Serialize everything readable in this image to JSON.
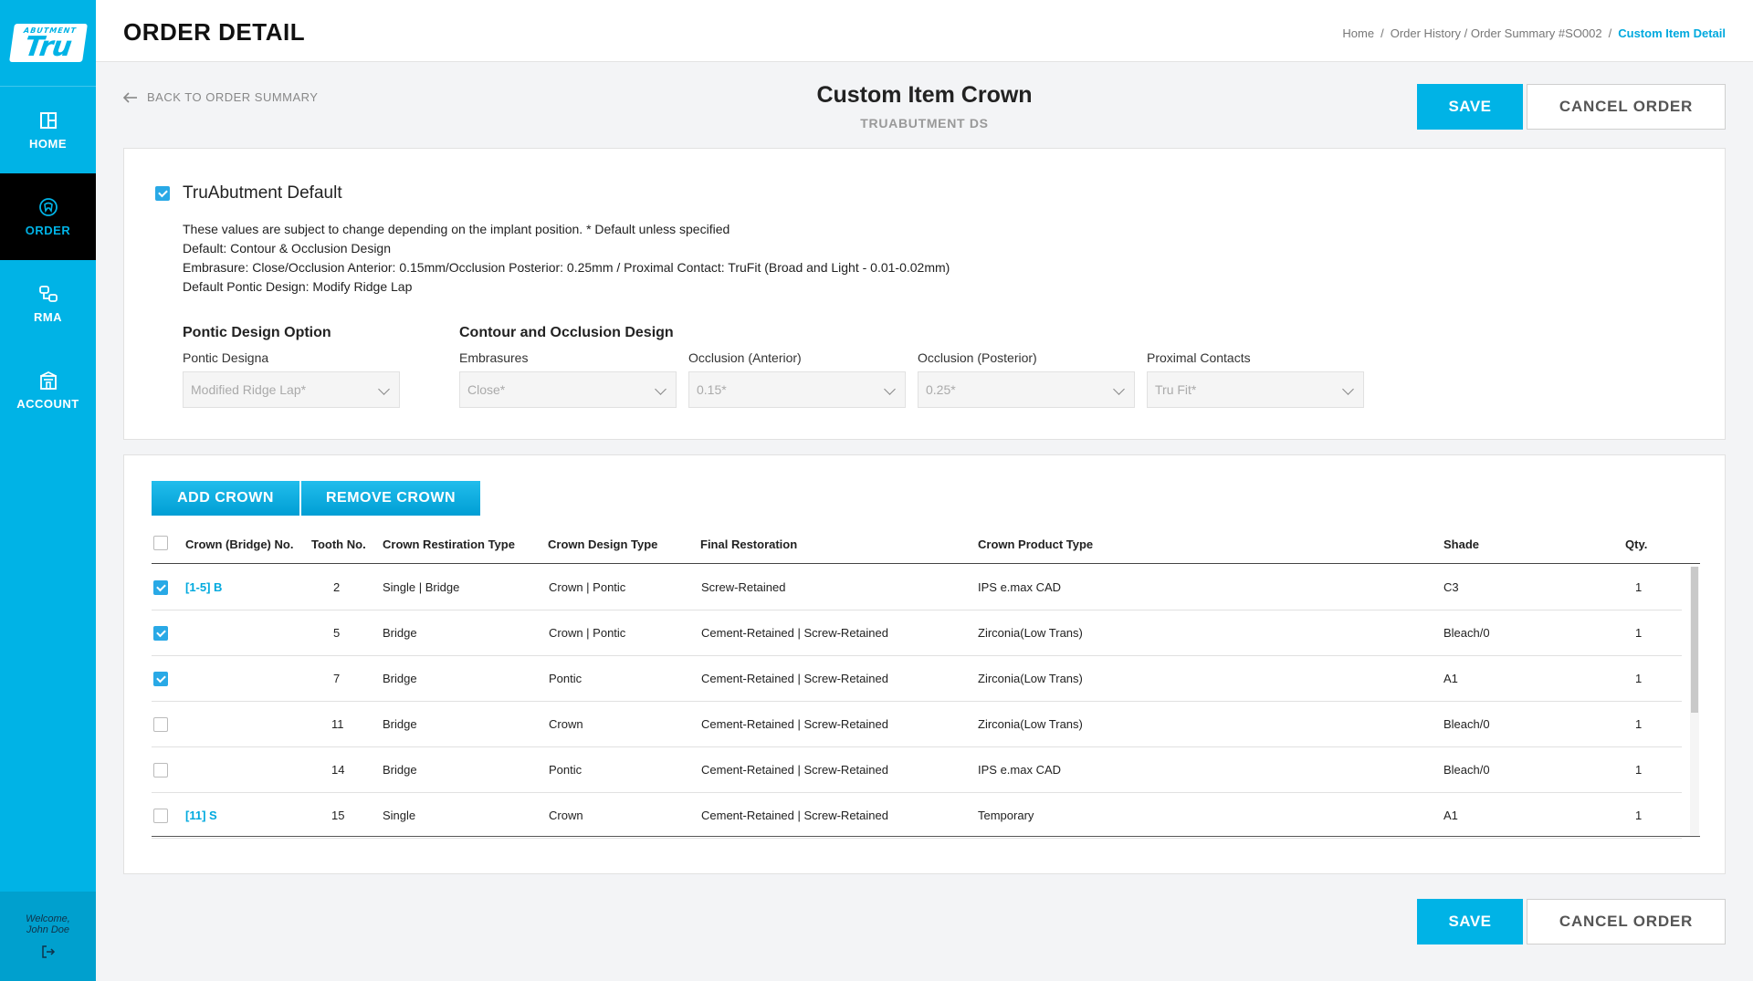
{
  "sidebar": {
    "logo_small": "ABUTMENT",
    "logo_big": "Tru",
    "items": [
      {
        "label": "HOME"
      },
      {
        "label": "ORDER"
      },
      {
        "label": "RMA"
      },
      {
        "label": "ACCOUNT"
      }
    ],
    "welcome_line1": "Welcome,",
    "welcome_line2": "John Doe"
  },
  "header": {
    "title": "ORDER DETAIL",
    "breadcrumb": [
      "Home",
      "Order History / Order Summary #SO002",
      "Custom Item Detail"
    ]
  },
  "top": {
    "back_label": "BACK TO ORDER SUMMARY",
    "item_title": "Custom Item Crown",
    "item_subtitle": "TRUABUTMENT DS",
    "save_label": "SAVE",
    "cancel_label": "CANCEL ORDER"
  },
  "defaults": {
    "checkbox_label": "TruAbutment Default",
    "checked": true,
    "notes": [
      "These values are subject to change depending on the implant position. * Default unless specified",
      "Default: Contour & Occlusion Design",
      "Embrasure: Close/Occlusion Anterior: 0.15mm/Occlusion Posterior: 0.25mm / Proximal Contact: TruFit (Broad and Light - 0.01-0.02mm)",
      "Default Pontic Design: Modify Ridge Lap"
    ],
    "pontic_group_title": "Pontic Design Option",
    "contour_group_title": "Contour and Occlusion Design",
    "fields": [
      {
        "label": "Pontic Designa",
        "value": "Modified Ridge Lap*"
      },
      {
        "label": "Embrasures",
        "value": "Close*"
      },
      {
        "label": "Occlusion (Anterior)",
        "value": "0.15*"
      },
      {
        "label": "Occlusion (Posterior)",
        "value": "0.25*"
      },
      {
        "label": "Proximal Contacts",
        "value": "Tru Fit*"
      }
    ]
  },
  "crowns": {
    "add_label": "ADD CROWN",
    "remove_label": "REMOVE CROWN",
    "columns": [
      "Crown (Bridge) No.",
      "Tooth No.",
      "Crown Restiration Type",
      "Crown Design Type",
      "Final Restoration",
      "Crown Product Type",
      "Shade",
      "Qty."
    ],
    "rows": [
      {
        "checked": true,
        "bridge": "[1-5] B",
        "tooth": "2",
        "restoration_type": "Single | Bridge",
        "design": "Crown | Pontic",
        "final": "Screw-Retained",
        "product": "IPS e.max CAD",
        "shade": "C3",
        "qty": "1"
      },
      {
        "checked": true,
        "bridge": "",
        "tooth": "5",
        "restoration_type": "Bridge",
        "design": "Crown | Pontic",
        "final": "Cement-Retained | Screw-Retained",
        "product": "Zirconia(Low Trans)",
        "shade": "Bleach/0",
        "qty": "1"
      },
      {
        "checked": true,
        "bridge": "",
        "tooth": "7",
        "restoration_type": "Bridge",
        "design": "Pontic",
        "final": "Cement-Retained | Screw-Retained",
        "product": "Zirconia(Low Trans)",
        "shade": "A1",
        "qty": "1"
      },
      {
        "checked": false,
        "bridge": "",
        "tooth": "11",
        "restoration_type": "Bridge",
        "design": "Crown",
        "final": "Cement-Retained | Screw-Retained",
        "product": "Zirconia(Low Trans)",
        "shade": "Bleach/0",
        "qty": "1"
      },
      {
        "checked": false,
        "bridge": "",
        "tooth": "14",
        "restoration_type": "Bridge",
        "design": "Pontic",
        "final": "Cement-Retained | Screw-Retained",
        "product": "IPS e.max CAD",
        "shade": "Bleach/0",
        "qty": "1"
      },
      {
        "checked": false,
        "bridge": "[11] S",
        "tooth": "15",
        "restoration_type": "Single",
        "design": "Crown",
        "final": "Cement-Retained | Screw-Retained",
        "product": "Temporary",
        "shade": "A1",
        "qty": "1"
      }
    ]
  },
  "colors": {
    "accent": "#00b3e6",
    "active_nav": "#000000",
    "link": "#00a9de"
  }
}
